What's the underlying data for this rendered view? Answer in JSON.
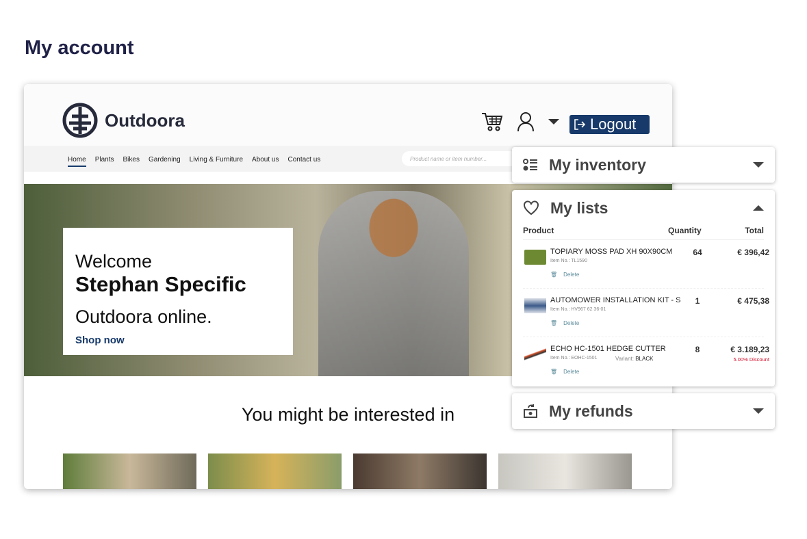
{
  "page_title": "My account",
  "site": {
    "brand": "Outdoora",
    "logout_label": "Logout",
    "nav": [
      "Home",
      "Plants",
      "Bikes",
      "Gardening",
      "Living & Furniture",
      "About us",
      "Contact us"
    ],
    "search_placeholder": "Product name or item number...",
    "hero": {
      "welcome": "Welcome",
      "name": "Stephan Specific",
      "tagline": "Outdoora online.",
      "cta": "Shop now"
    },
    "interest_heading": "You might be interested in",
    "accent_color": "#173a6a"
  },
  "panels": {
    "inventory": {
      "title": "My inventory",
      "icon": "list-icon"
    },
    "lists": {
      "title": "My lists",
      "icon": "heart-icon",
      "columns": [
        "Product",
        "Quantity",
        "Total"
      ],
      "items": [
        {
          "name": "TOPIARY MOSS PAD XH 90X90CM",
          "item_no": "Item No.: TL1590",
          "qty": "64",
          "total": "€ 396,42",
          "delete": "Delete"
        },
        {
          "name": "AUTOMOWER INSTALLATION KIT - S",
          "item_no": "Item No.: HV967 62 36-01",
          "qty": "1",
          "total": "€ 475,38",
          "delete": "Delete"
        },
        {
          "name": "ECHO HC-1501 HEDGE CUTTER",
          "item_no": "Item No.: EOHC-1501",
          "variant_label": "Variant:",
          "variant": "BLACK",
          "qty": "8",
          "total": "€ 3.189,23",
          "discount": "5.00% Discount",
          "delete": "Delete"
        }
      ]
    },
    "refunds": {
      "title": "My refunds",
      "icon": "refund-icon"
    }
  }
}
